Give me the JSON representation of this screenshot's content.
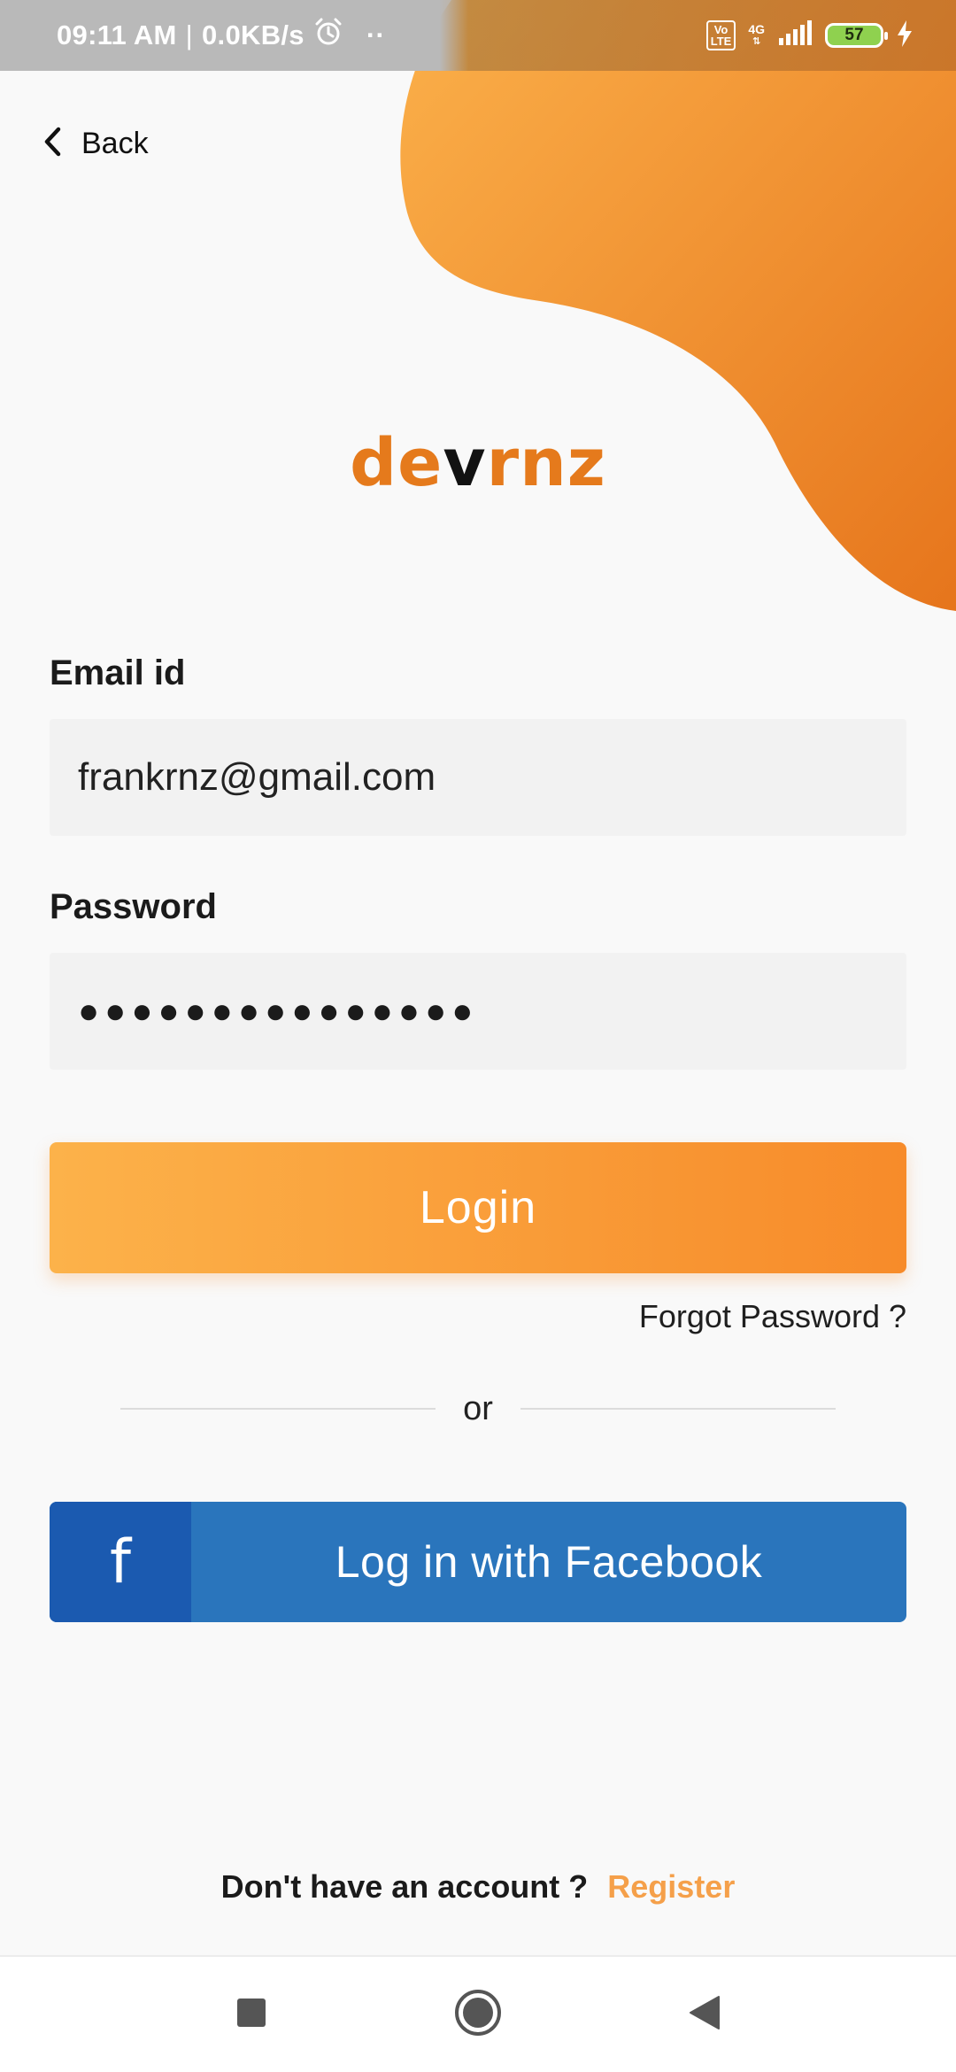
{
  "status_bar": {
    "time": "09:11 AM",
    "separator": "|",
    "speed": "0.0KB/s",
    "dots": "··",
    "volte_top": "Vo",
    "volte_bottom": "LTE",
    "network": "4G",
    "battery": "57"
  },
  "header": {
    "back_label": "Back"
  },
  "logo": {
    "part1": "de",
    "part2": "v",
    "part3": "rnz"
  },
  "form": {
    "email_label": "Email id",
    "email_value": "frankrnz@gmail.com",
    "password_label": "Password",
    "password_masked": "●●●●●●●●●●●●●●●"
  },
  "actions": {
    "login_label": "Login",
    "forgot_label": "Forgot Password ?",
    "or_label": "or",
    "facebook_icon": "f",
    "facebook_label": "Log in with Facebook"
  },
  "footer": {
    "question": "Don't have an account ?",
    "register_label": "Register"
  },
  "icons": {
    "back": "chevron-left-icon",
    "alarm": "alarm-icon",
    "signal": "signal-icon",
    "charging": "charging-icon",
    "nav_recents": "square-icon",
    "nav_home": "circle-icon",
    "nav_back": "triangle-back-icon"
  },
  "colors": {
    "accent_orange": "#f78b2a",
    "accent_light": "#fcb24a",
    "facebook_blue": "#2a75bc",
    "facebook_dark": "#1b5ab0",
    "register_link": "#f5a04a"
  }
}
